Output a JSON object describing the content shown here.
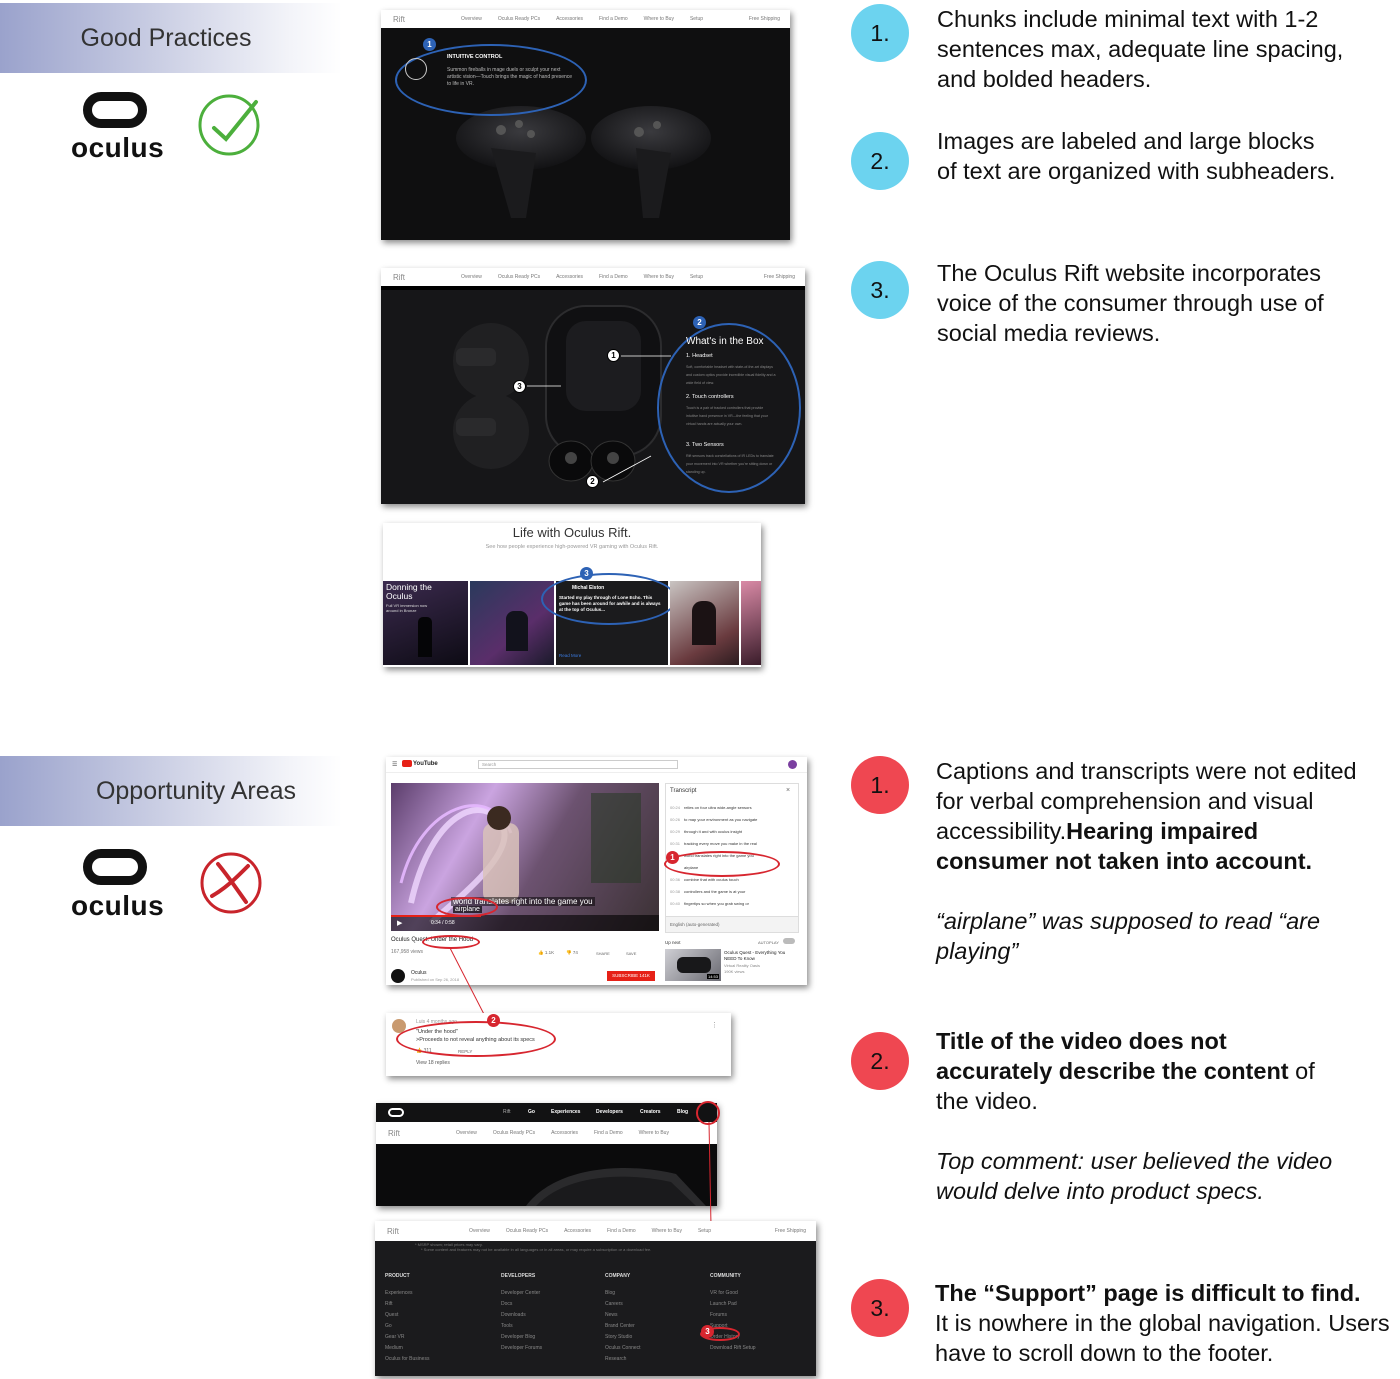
{
  "good": {
    "banner": "Good Practices",
    "logo_text": "oculus",
    "check_icon": "check-circle-icon",
    "notes": [
      {
        "num": "1.",
        "text": "Chunks include minimal text with 1-2 sentences max, adequate line spacing, and bolded headers."
      },
      {
        "num": "2.",
        "text": "Images are labeled and large blocks of text are organized with subheaders."
      },
      {
        "num": "3.",
        "text": "The Oculus Rift website incorporates voice of the consumer through use of social media reviews."
      }
    ]
  },
  "opportunity": {
    "banner": "Opportunity Areas",
    "logo_text": "oculus",
    "x_icon": "x-circle-icon",
    "notes": [
      {
        "num": "1.",
        "text_plain": "Captions and transcripts were not edited for verbal comprehension and visual accessibility.",
        "text_bold": "Hearing impaired consumer not taken into account.",
        "text_italic": "“airplane” was supposed to read “are playing”"
      },
      {
        "num": "2.",
        "text_bold": "Title of the video does not accurately describe the content",
        "text_plain": "of the video.",
        "text_italic": "Top comment: user believed the video would delve into product specs."
      },
      {
        "num": "3.",
        "text_bold": "The “Support” page is difficult to find.",
        "text_plain": "It is nowhere in the global navigation. Users have to scroll down to the footer."
      }
    ]
  },
  "site_nav": {
    "brand": "Rift",
    "items": [
      "Overview",
      "Oculus Ready PCs",
      "Accessories",
      "Find a Demo",
      "Where to Buy",
      "Setup"
    ],
    "shipping": "Free Shipping"
  },
  "shot1": {
    "badge": "1",
    "heading": "INTUITIVE CONTROL",
    "body": "Summon fireballs in mage duels or sculpt your next artistic vision—Touch brings the magic of hand presence to life in VR."
  },
  "shot2": {
    "badge": "2",
    "title": "What's in the Box",
    "items": [
      {
        "h": "1. Headset",
        "b": "Soft, comfortable headset with state-of-the-art displays and custom optics provide incredible visual fidelity and a wide field of view."
      },
      {
        "h": "2. Touch controllers",
        "b": "Touch is a pair of tracked controllers that provide intuitive hand presence in VR—the feeling that your virtual hands are actually your own."
      },
      {
        "h": "3. Two Sensors",
        "b": "Rift sensors track constellations of IR LEDs to translate your movement into VR whether you're sitting down or standing up."
      }
    ],
    "markers": [
      "1",
      "2",
      "3"
    ]
  },
  "shot3": {
    "title": "Life with Oculus Rift.",
    "subtitle": "See how people experience high-powered VR gaming with Oculus Rift.",
    "tile_title": "Donning the Oculus",
    "tile_sub": "Full VR immersion now around in Bronze",
    "badge": "3",
    "review_user": "Michal Elston",
    "review_text": "Started my play through of Lone Echo. This game has been around for awhile and is always at the top of Oculus...",
    "read_more": "Read More"
  },
  "youtube": {
    "logo": "YouTube",
    "search_placeholder": "Search",
    "transcript_title": "Transcript",
    "transcript_lines": [
      {
        "t": "00:24",
        "s": "relies on four ultra wide-angle sensors"
      },
      {
        "t": "00:26",
        "s": "to map your environment as you navigate"
      },
      {
        "t": "00:29",
        "s": "through it and with oculus insight"
      },
      {
        "t": "00:31",
        "s": "tracking every move you make in the real"
      },
      {
        "t": "00:34",
        "s": "world translates right into the game you"
      },
      {
        "t": "",
        "s": "airplane"
      },
      {
        "t": "00:36",
        "s": "combine that with oculus touch"
      },
      {
        "t": "00:38",
        "s": "controllers and the game is at your"
      },
      {
        "t": "00:40",
        "s": "fingertips so when you grab swing or"
      }
    ],
    "transcript_lang": "English (auto-generated)",
    "caption_line1": "world translates right into the game you",
    "caption_line2": "airplane",
    "time": "0:34 / 0:58",
    "video_title_prefix": "Oculus Quest:",
    "video_title": "Under the Hood",
    "views": "167,958 views",
    "likes": "1.1K",
    "dislikes": "74",
    "share": "SHARE",
    "save": "SAVE",
    "channel": "Oculus",
    "published": "Published on Sep 26, 2018",
    "subscribe": "SUBSCRIBE 141K",
    "up_next": "Up next",
    "autoplay": "AUTOPLAY",
    "next_title": "Oculus Quest - Everything You NEED To Know",
    "next_channel": "Virtual Reality Oasis",
    "next_views": "190K views",
    "next_duration": "14:53",
    "badge": "1"
  },
  "comment": {
    "user": "Luis",
    "age": "4 months ago",
    "line1": "\"Under the hood\"",
    "line2": ">Proceeds to not reveal anything about its specs",
    "likes": "311",
    "reply": "REPLY",
    "view_replies": "View 18 replies",
    "badge": "2"
  },
  "global_nav": {
    "items": [
      "Rift",
      "Go",
      "Experiences",
      "Developers",
      "Creators",
      "Blog"
    ]
  },
  "footer": {
    "disclaimer1": "* MSRP shown; retail prices may vary.",
    "disclaimer2": "* Some content and features may not be available in all languages or in all areas, or may require a subscription or a download fee.",
    "columns": [
      {
        "h": "PRODUCT",
        "items": [
          "Experiences",
          "Rift",
          "Quest",
          "Go",
          "Gear VR",
          "Medium",
          "Oculus for Business"
        ]
      },
      {
        "h": "DEVELOPERS",
        "items": [
          "Developer Center",
          "Docs",
          "Downloads",
          "Tools",
          "Developer Blog",
          "Developer Forums"
        ]
      },
      {
        "h": "COMPANY",
        "items": [
          "Blog",
          "Careers",
          "News",
          "Brand Center",
          "Story Studio",
          "Oculus Connect",
          "Research"
        ]
      },
      {
        "h": "COMMUNITY",
        "items": [
          "VR for Good",
          "Launch Pad",
          "Forums",
          "Support",
          "Order History",
          "Download Rift Setup"
        ]
      }
    ],
    "badge": "3"
  },
  "colors": {
    "blue_circle": "#6cd3ef",
    "red_circle": "#ef4751",
    "annot_blue": "#2d62b5",
    "annot_red": "#d7262f",
    "check_green": "#4caf3c"
  }
}
